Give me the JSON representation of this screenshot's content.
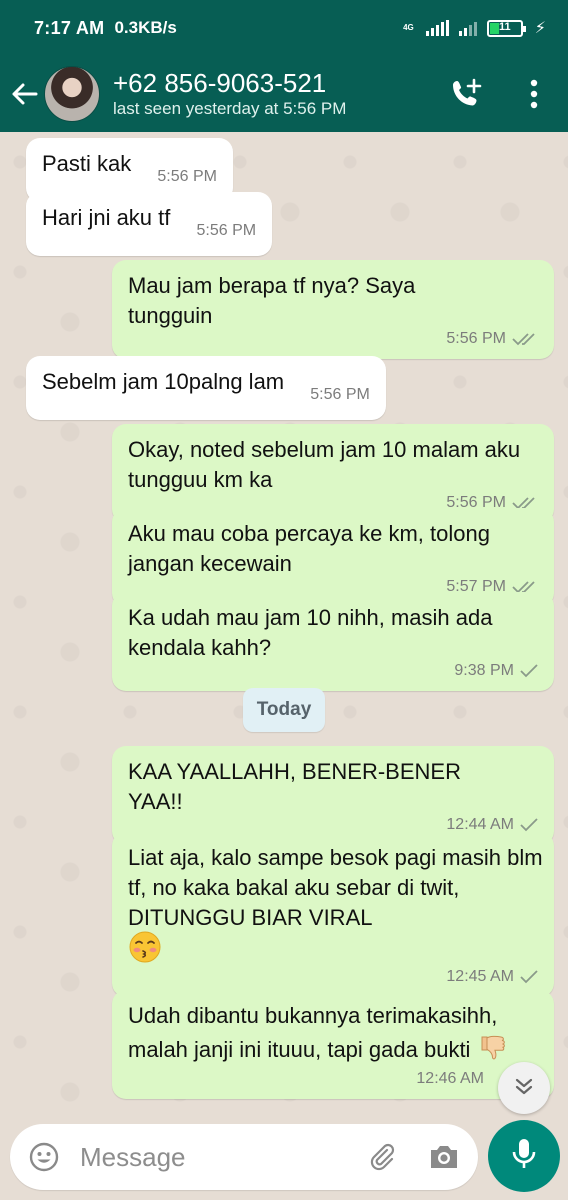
{
  "status": {
    "time": "7:17 AM",
    "network_speed": "0.3KB/s",
    "signal_label": "4G",
    "battery_level": "11",
    "charging": true
  },
  "header": {
    "contact_name": "+62 856-9063-521",
    "last_seen": "last seen yesterday at 5:56 PM",
    "icons": [
      "back-arrow-icon",
      "avatar",
      "add-call-icon",
      "more-vert-icon"
    ]
  },
  "messages": [
    {
      "dir": "in",
      "text": "Pasti kak",
      "time": "5:56 PM"
    },
    {
      "dir": "in",
      "text": "Hari jni aku tf",
      "time": "5:56 PM"
    },
    {
      "dir": "out",
      "text": "Mau jam berapa tf nya? Saya tungguin",
      "time": "5:56 PM",
      "status": "read"
    },
    {
      "dir": "in",
      "text": "Sebelm jam 10palng lam",
      "time": "5:56 PM"
    },
    {
      "dir": "out",
      "text": "Okay, noted sebelum jam 10 malam aku tungguu km ka",
      "time": "5:56 PM",
      "status": "read"
    },
    {
      "dir": "out",
      "text": "Aku mau coba percaya ke km, tolong jangan kecewain",
      "time": "5:57 PM",
      "status": "read"
    },
    {
      "dir": "out",
      "text": "Ka udah mau jam 10 nihh, masih ada kendala kahh?",
      "time": "9:38 PM",
      "status": "sent"
    },
    {
      "dir": "out",
      "text": "KAA YAALLAHH, BENER-BENER YAA!!",
      "time": "12:44 AM",
      "status": "sent"
    },
    {
      "dir": "out",
      "text": "Liat aja, kalo sampe besok pagi masih blm tf, no kaka bakal aku sebar di twit, DITUNGGU BIAR VIRAL",
      "time": "12:45 AM",
      "status": "sent",
      "emoji": "kissing-face-emoji"
    },
    {
      "dir": "out",
      "text": "Udah dibantu bukannya terimakasihh, malah janji ini ituuu, tapi gada bukti",
      "time": "12:46 AM",
      "status": "sent",
      "emoji": "thumbs-down-emoji"
    }
  ],
  "date_divider": "Today",
  "input": {
    "placeholder": "Message"
  },
  "colors": {
    "header": "#075e54",
    "incoming_bubble": "#ffffff",
    "outgoing_bubble": "#dcf8c6",
    "mic_button": "#00897b",
    "chat_background": "#e6ddd4"
  }
}
